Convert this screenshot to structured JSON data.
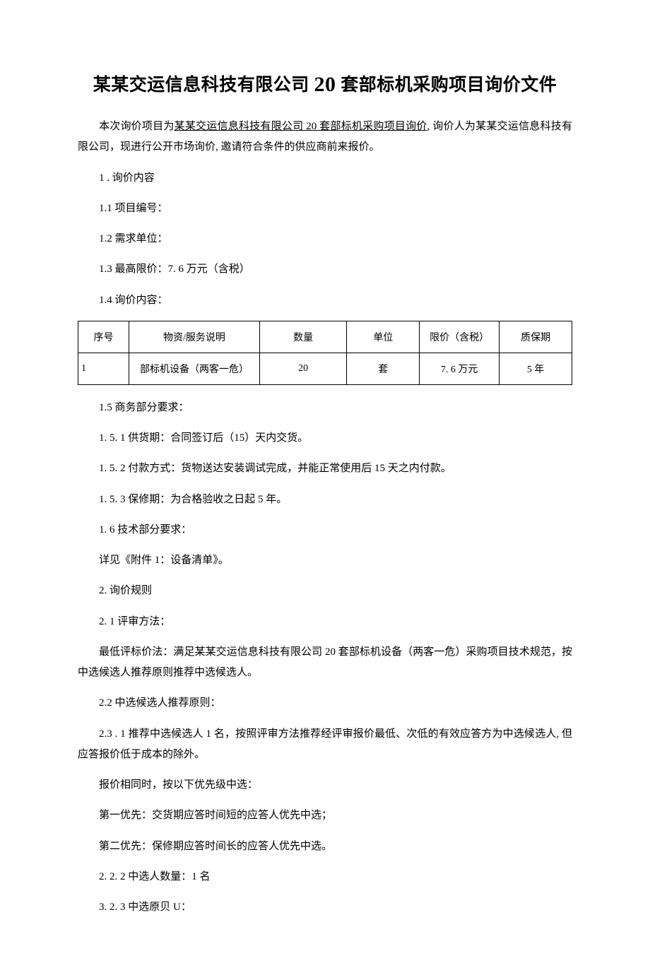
{
  "title_pre": "某某交运信息科技有限公司",
  "title_num": "20",
  "title_post": "套部标机采购项目询价文件",
  "intro_prefix": "本次询价项目为",
  "intro_underlined": "某某交运信息科技有限公司 20 套部标机采购项目询价",
  "intro_suffix": ", 询价人为某某交运信息科技有限公司，现进行公开市场询价, 邀请符合条件的供应商前来报价。",
  "sec1": "1 . 询价内容",
  "sec1_1": "1.1  项目编号：",
  "sec1_2": "1.2  需求单位：",
  "sec1_3": "1.3  最高限价：7. 6 万元（含税）",
  "sec1_4": "1.4  询价内容：",
  "table": {
    "headers": {
      "seq": "序号",
      "desc": "物资/服务说明",
      "qty": "数量",
      "unit": "单位",
      "price": "限价（含税）",
      "warranty": "质保期"
    },
    "row": {
      "seq": "1",
      "desc": "部标机设备（两客一危）",
      "qty": "20",
      "unit": "套",
      "price": "7. 6 万元",
      "warranty": "5 年"
    }
  },
  "sec1_5": "1.5  商务部分要求：",
  "sec1_5_1": "1. 5. 1  供货期：合同签订后（15）天内交货。",
  "sec1_5_2": "1. 5. 2 付款方式：货物送达安装调试完成，并能正常使用后 15 天之内付款。",
  "sec1_5_3": "1. 5. 3 保修期：为合格验收之日起 5 年。",
  "sec1_6": "1. 6 技术部分要求：",
  "sec1_6_detail": "详见《附件 1：设备清单》。",
  "sec2": "2. 询价规则",
  "sec2_1": "2.  1 评审方法：",
  "sec2_1_detail": "最低评标价法：满足某某交运信息科技有限公司 20 套部标机设备（两客一危）采购项目技术规范，按中选候选人推荐原则推荐中选候选人。",
  "sec2_2": "2.2  中选候选人推荐原则：",
  "sec2_2_1": "2.3  . 1 推荐中选候选人 1 名，按照评审方法推荐经评审报价最低、次低的有效应答方为中选候选人, 但应答报价低于成本的除外。",
  "sec2_2_1b": "报价相同时，按以下优先级中选：",
  "sec2_2_1c": "第一优先：交货期应答时间短的应答人优先中选；",
  "sec2_2_1d": "第二优先：保修期应答时间长的应答人优先中选。",
  "sec2_2_2": "2.  2. 2 中选人数量：1 名",
  "sec2_2_3": "3.  2. 3 中选原贝 U："
}
